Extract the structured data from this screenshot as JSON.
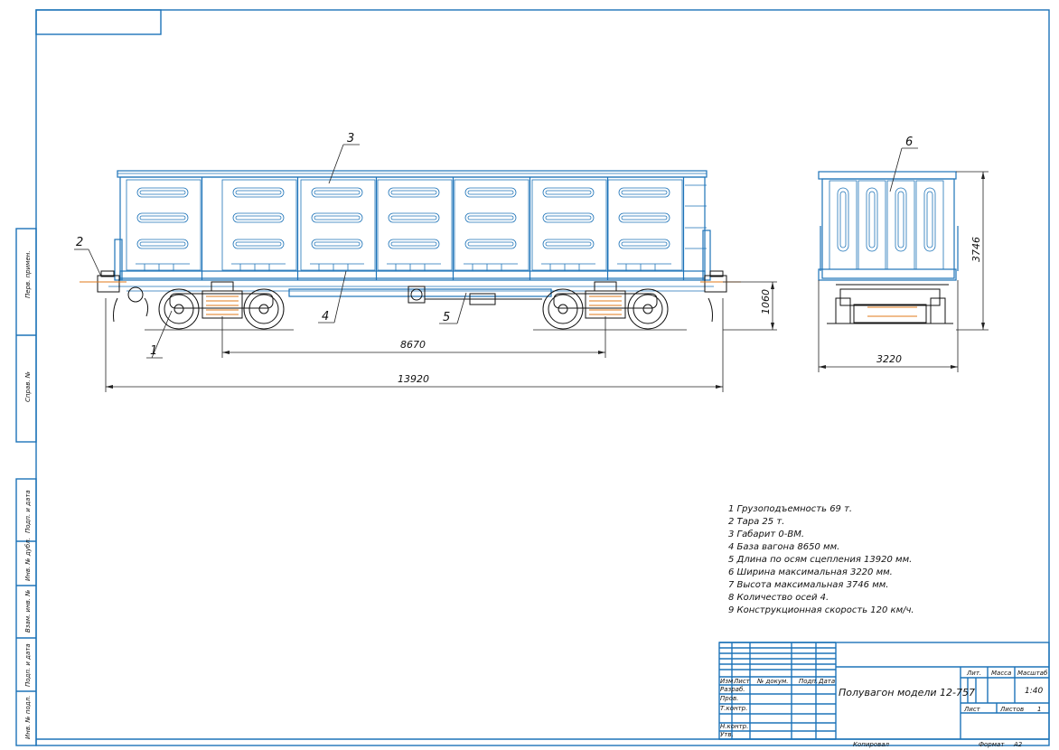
{
  "drawing": {
    "leaders": [
      "1",
      "2",
      "3",
      "4",
      "5",
      "6"
    ],
    "dimensions": {
      "wheelbase": "8670",
      "coupling_length": "13920",
      "coupler_height": "1060",
      "width": "3220",
      "height": "3746"
    },
    "notes": [
      "1 Грузоподъемность 69 т.",
      "2 Тара 25 т.",
      "3 Габарит 0-ВМ.",
      "4 База вагона 8650 мм.",
      "5 Длина по осям сцепления 13920 мм.",
      "6 Ширина максимальная 3220 мм.",
      "7 Высота максимальная 3746 мм.",
      "8 Количество осей 4.",
      "9 Конструкционная скорость 120 км/ч."
    ],
    "side_stamp": [
      "Перв. примен.",
      "Справ. №",
      "Подп. и дата",
      "Инв. № дубл.",
      "Взам. инв. №",
      "Подп. и дата",
      "Инв. № подл."
    ]
  },
  "title_block": {
    "title": "Полувагон модели 12-757",
    "header_cols": [
      "Изм",
      "Лист",
      "№ докум.",
      "Подп.",
      "Дата"
    ],
    "rows": [
      "Разраб.",
      "Пров.",
      "Т.контр.",
      "",
      "Н.контр.",
      "Утв."
    ],
    "lit_label": "Лит.",
    "mass_label": "Масса",
    "scale_label": "Масштаб",
    "scale_value": "1:40",
    "sheet_label": "Лист",
    "sheets_label": "Листов",
    "sheets_value": "1",
    "copied_label": "Копировал",
    "format_label": "Формат",
    "format_value": "А2"
  }
}
